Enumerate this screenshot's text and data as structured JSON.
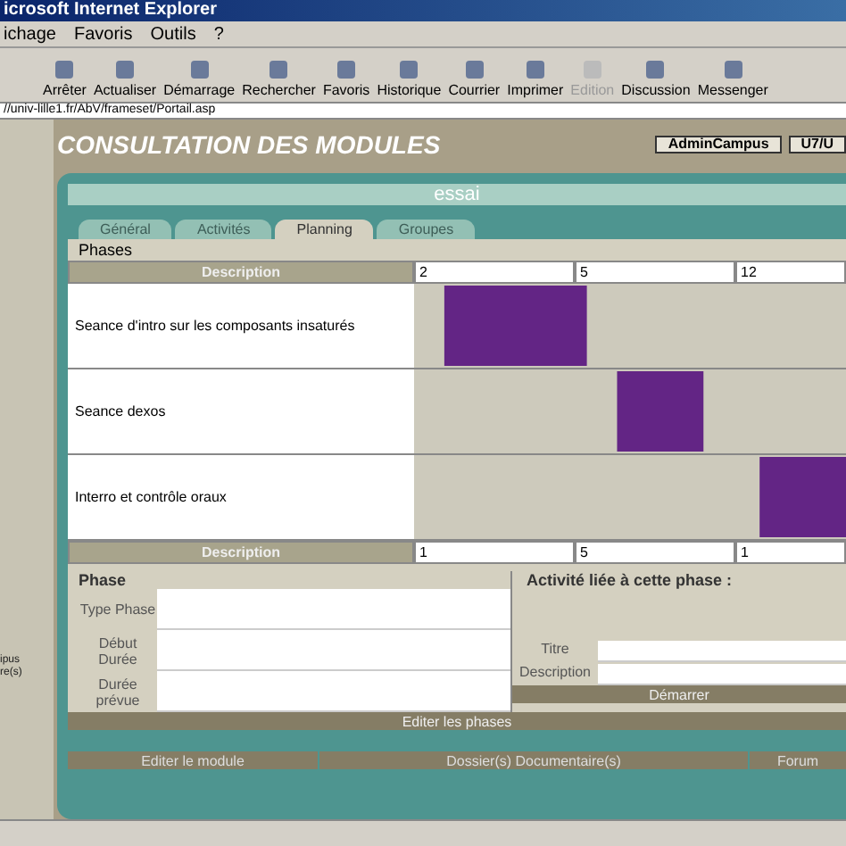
{
  "window": {
    "title": "icrosoft Internet Explorer"
  },
  "menu": [
    "ichage",
    "Favoris",
    "Outils",
    "?"
  ],
  "toolbar": [
    {
      "label": "Arrêter",
      "disabled": false
    },
    {
      "label": "Actualiser",
      "disabled": false
    },
    {
      "label": "Démarrage",
      "disabled": false
    },
    {
      "label": "Rechercher",
      "disabled": false
    },
    {
      "label": "Favoris",
      "disabled": false
    },
    {
      "label": "Historique",
      "disabled": false
    },
    {
      "label": "Courrier",
      "disabled": false
    },
    {
      "label": "Imprimer",
      "disabled": false
    },
    {
      "label": "Edition",
      "disabled": true
    },
    {
      "label": "Discussion",
      "disabled": false
    },
    {
      "label": "Messenger",
      "disabled": false
    }
  ],
  "address": "//univ-lille1.fr/AbV/frameset/Portail.asp",
  "sidebar": {
    "texts": [
      "ipus",
      "re(s)"
    ]
  },
  "header": {
    "title": "CONSULTATION DES MODULES",
    "buttons": [
      "AdminCampus",
      "U7/U"
    ]
  },
  "module": {
    "title": "essai",
    "tabs": [
      {
        "label": "Général",
        "selected": false
      },
      {
        "label": "Activités",
        "selected": false
      },
      {
        "label": "Planning",
        "selected": true
      },
      {
        "label": "Groupes",
        "selected": false
      }
    ],
    "phases_title": "Phases",
    "columns": [
      "Description",
      "2",
      "5",
      "12"
    ],
    "phases": [
      "Seance d'intro sur les composants insaturés",
      "Seance dexos",
      "Interro et contrôle oraux"
    ],
    "footer_columns": [
      "Description",
      "1",
      "5",
      "1"
    ],
    "form": {
      "title": "Phase",
      "fields": [
        "Type Phase",
        "Début Durée",
        "Durée prévue"
      ],
      "activity_title": "Activité liée à cette phase :",
      "activity_fields": [
        "Titre",
        "Description"
      ],
      "start_button": "Démarrer",
      "edit_button": "Editer les phases"
    },
    "bottom_buttons": [
      "Editer le module",
      "Dossier(s) Documentaire(s)",
      "Forum"
    ]
  }
}
